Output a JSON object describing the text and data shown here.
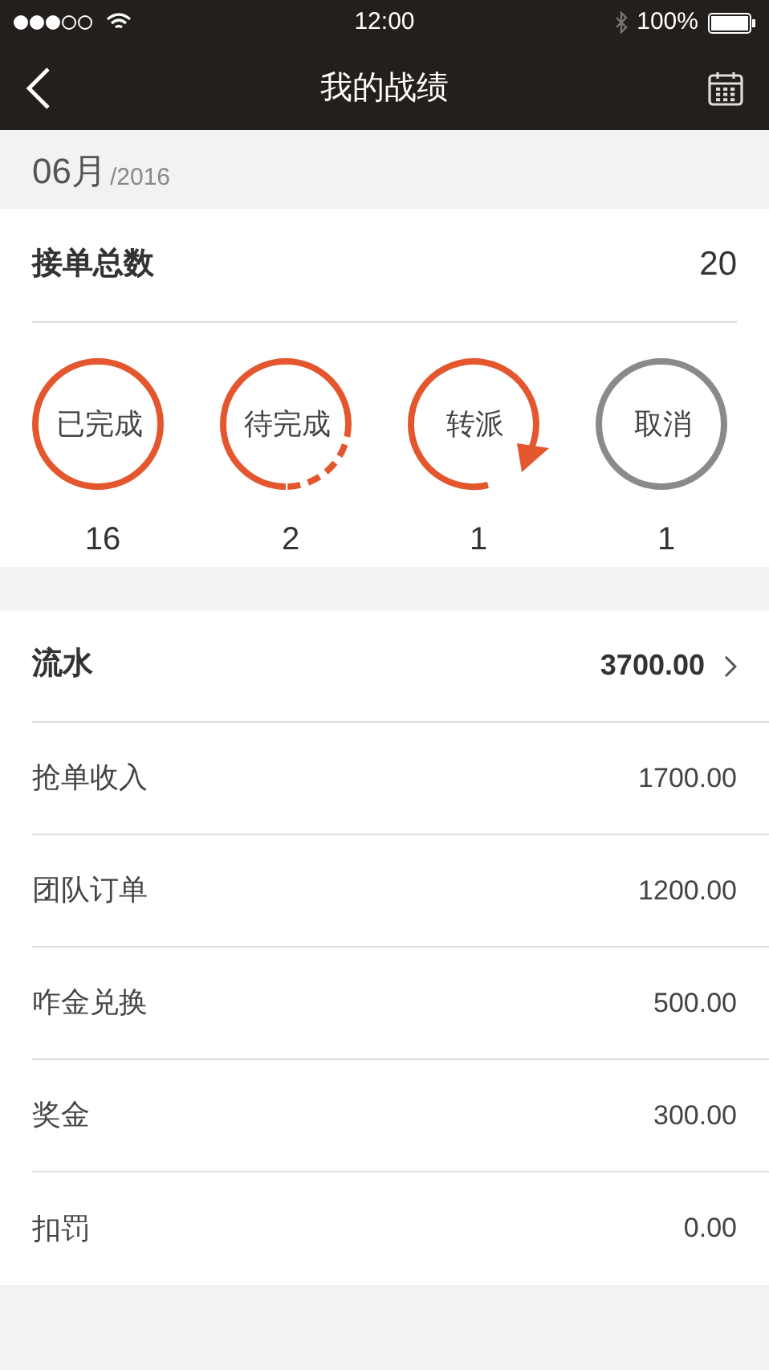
{
  "status_bar": {
    "time": "12:00",
    "battery": "100%"
  },
  "nav": {
    "title": "我的战绩"
  },
  "period": {
    "month": "06月",
    "year": "/2016"
  },
  "summary": {
    "label": "接单总数",
    "value": "20"
  },
  "statuses": [
    {
      "kind": "done",
      "label": "已完成",
      "count": "16"
    },
    {
      "kind": "pending",
      "label": "待完成",
      "count": "2"
    },
    {
      "kind": "transfer",
      "label": "转派",
      "count": "1"
    },
    {
      "kind": "cancel",
      "label": "取消",
      "count": "1"
    }
  ],
  "income": [
    {
      "label": "流水",
      "value": "3700.00",
      "kind": "total"
    },
    {
      "label": "抢单收入",
      "value": "1700.00",
      "kind": "item"
    },
    {
      "label": "团队订单",
      "value": "1200.00",
      "kind": "item"
    },
    {
      "label": "咋金兑换",
      "value": "500.00",
      "kind": "item"
    },
    {
      "label": "奖金",
      "value": "300.00",
      "kind": "item"
    },
    {
      "label": "扣罚",
      "value": "0.00",
      "kind": "item"
    }
  ]
}
